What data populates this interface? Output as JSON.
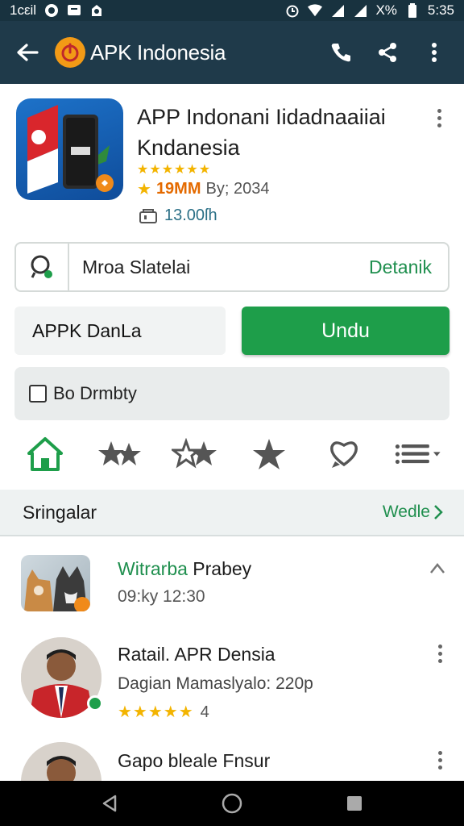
{
  "status_bar": {
    "left_text": "1cεil",
    "battery_text": "X%",
    "time": "5:35",
    "icons": [
      "whatsapp-icon",
      "messages-icon",
      "notification-icon",
      "alarm-icon",
      "wifi-icon",
      "signal-icon",
      "signal-icon",
      "battery-icon"
    ]
  },
  "app_bar": {
    "title": "APK Indonesia",
    "icons": [
      "back-arrow-icon",
      "app-logo-icon",
      "phone-icon",
      "share-icon",
      "more-vert-icon"
    ],
    "colors": {
      "background": "#1f3a4a",
      "logo": "#f29a16"
    }
  },
  "app": {
    "title": "APP Indonani Iidadnaaiiai Kndanesia",
    "stars": "★★★★★★",
    "rating": "19MM",
    "rating_prefix": "★",
    "by_text": "By; 2034",
    "size": "13.00ſh"
  },
  "detail": {
    "text": "Mroa Slatelai",
    "link": "Detanik"
  },
  "download": {
    "label": "APPK DanLa",
    "button": "Undu",
    "button_color": "#1e9e4a"
  },
  "checkbox": {
    "label": "Bo Drmbty",
    "checked": false
  },
  "nav_icons": [
    "home-icon",
    "stars-icon",
    "stars-outline-icon",
    "star-icon",
    "heart-chat-icon",
    "list-menu-icon"
  ],
  "section": {
    "title": "Sringalar",
    "more": "Wedle"
  },
  "list": [
    {
      "title_accent": "Witrarba",
      "title": " Prabey",
      "subtitle": "09:ky 12:30"
    },
    {
      "title": "Ratail. APR Densia",
      "subtitle": "Dagian Mamaslyalo: 220p",
      "stars": "★★★★★",
      "rating": "4"
    },
    {
      "title": "Gapo bleale Fnsur"
    }
  ],
  "nav_bar": {
    "icons": [
      "back-triangle-icon",
      "home-circle-icon",
      "recents-square-icon"
    ]
  }
}
